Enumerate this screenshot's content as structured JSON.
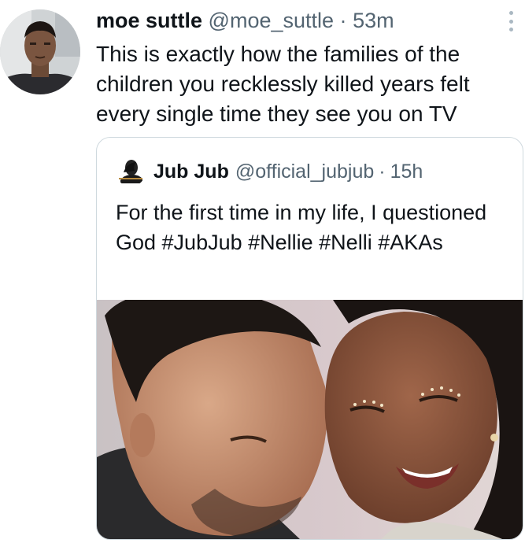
{
  "tweet": {
    "author_name": "moe suttle",
    "author_handle": "@moe_suttle",
    "separator": "·",
    "time": "53m",
    "text": "This is exactly how the families of the children you recklessly killed years felt every single time they see you on TV",
    "more_icon": "more-vertical-icon"
  },
  "quoted": {
    "author_name": "Jub Jub",
    "author_handle": "@official_jubjub",
    "separator": "·",
    "time": "15h",
    "text": "For the first time in my life, I questioned God #JubJub #Nellie #Nelli #AKAs"
  },
  "colors": {
    "text_primary": "#0f1419",
    "text_secondary": "#536471",
    "border": "#cfd9de"
  }
}
